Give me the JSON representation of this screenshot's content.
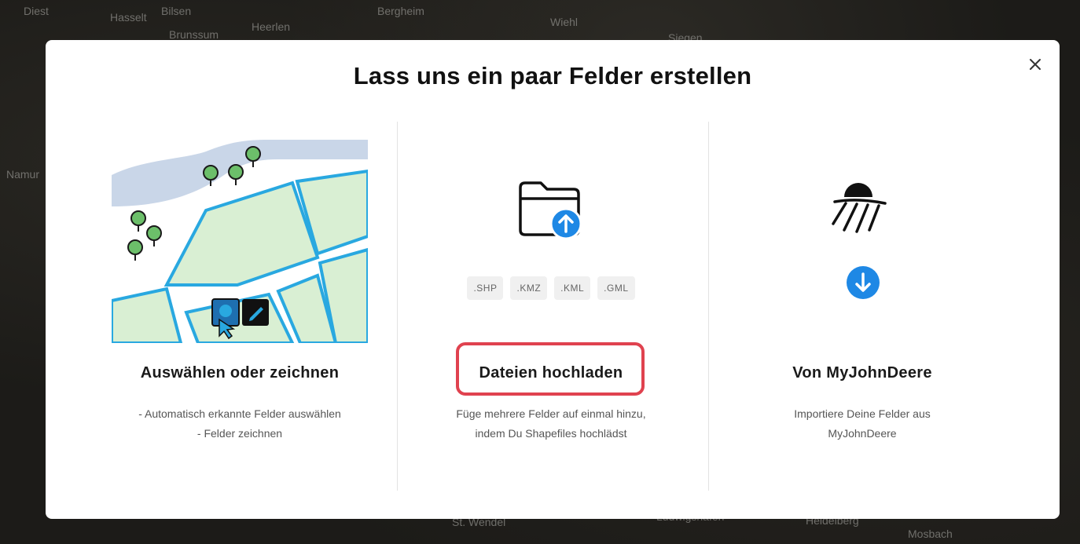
{
  "background_map": {
    "labels": [
      "Diest",
      "Hasselt",
      "Heerlen",
      "Bergheim",
      "Wiehl",
      "Siegen",
      "Namur",
      "St. Wendel",
      "Ludwigshafen",
      "Heidelberg",
      "Mosbach",
      "Bilsen",
      "Brunssum"
    ]
  },
  "modal": {
    "title": "Lass uns ein paar Felder erstellen",
    "close_icon": "close-icon"
  },
  "options": [
    {
      "title": "Auswählen oder zeichnen",
      "desc_lines": [
        "- Automatisch erkannte Felder auswählen",
        "- Felder zeichnen"
      ]
    },
    {
      "title": "Dateien hochladen",
      "desc_lines": [
        "Füge mehrere Felder auf einmal hinzu,",
        "indem Du Shapefiles hochlädst"
      ],
      "file_types": [
        ".SHP",
        ".KMZ",
        ".KML",
        ".GML"
      ]
    },
    {
      "title": "Von MyJohnDeere",
      "desc_lines": [
        "Importiere Deine Felder aus",
        "MyJohnDeere"
      ]
    }
  ],
  "colors": {
    "accent_blue": "#1e88e5",
    "field_stroke": "#29a8e0",
    "field_fill": "#d9efd3",
    "river": "#c9d6e8",
    "highlight": "#e0424f"
  }
}
